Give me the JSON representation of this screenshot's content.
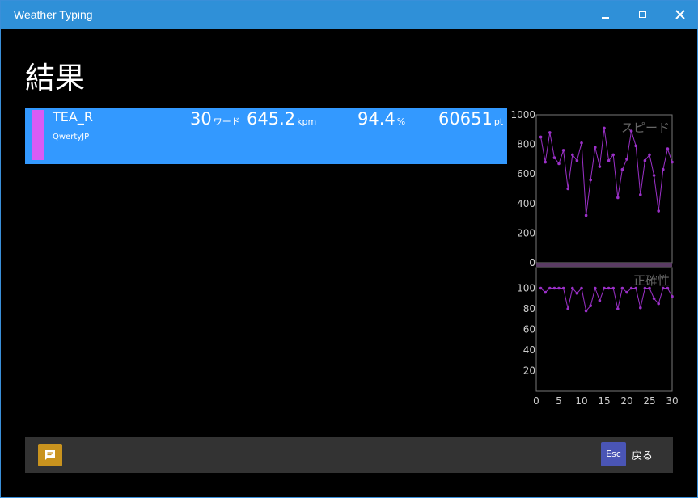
{
  "window": {
    "title": "Weather Typing"
  },
  "page": {
    "heading": "結果"
  },
  "result": {
    "player": "TEA_R",
    "layout": "QwertyJP",
    "words": "30",
    "words_unit": "ワード",
    "kpm": "645.2",
    "kpm_unit": "kpm",
    "accuracy": "94.4",
    "accuracy_unit": "%",
    "score": "60651",
    "score_unit": "pt",
    "color": "#d95cf5"
  },
  "footer": {
    "chat_icon": "chat-bubble-icon",
    "esc_key": "Esc",
    "back_label": "戻る"
  },
  "colors": {
    "titlebar": "#2f90d8",
    "result_row": "#3399ff",
    "series": "#9b30c8",
    "chat_button": "#c9931e",
    "esc_key": "#4a55b5"
  },
  "chart_data": [
    {
      "type": "line",
      "title": "スピード",
      "x": [
        1,
        2,
        3,
        4,
        5,
        6,
        7,
        8,
        9,
        10,
        11,
        12,
        13,
        14,
        15,
        16,
        17,
        18,
        19,
        20,
        21,
        22,
        23,
        24,
        25,
        26,
        27,
        28,
        29,
        30
      ],
      "values": [
        850,
        680,
        880,
        710,
        670,
        760,
        500,
        730,
        690,
        810,
        320,
        560,
        780,
        650,
        910,
        690,
        730,
        440,
        630,
        700,
        890,
        790,
        460,
        690,
        730,
        590,
        350,
        630,
        770,
        680
      ],
      "ylim": [
        0,
        1000
      ],
      "yticks": [
        "0",
        "200",
        "400",
        "600",
        "800",
        "1000"
      ]
    },
    {
      "type": "line",
      "title": "正確性",
      "x": [
        1,
        2,
        3,
        4,
        5,
        6,
        7,
        8,
        9,
        10,
        11,
        12,
        13,
        14,
        15,
        16,
        17,
        18,
        19,
        20,
        21,
        22,
        23,
        24,
        25,
        26,
        27,
        28,
        29,
        30
      ],
      "values": [
        100,
        96,
        100,
        100,
        100,
        100,
        80,
        100,
        95,
        100,
        78,
        83,
        100,
        88,
        100,
        100,
        100,
        80,
        100,
        96,
        100,
        100,
        81,
        100,
        100,
        90,
        85,
        100,
        100,
        92
      ],
      "ylim": [
        0,
        120
      ],
      "yticks": [
        "20",
        "40",
        "60",
        "80",
        "100"
      ],
      "xticks": [
        "0",
        "5",
        "10",
        "15",
        "20",
        "25",
        "30"
      ],
      "xlim": [
        0,
        30
      ]
    }
  ]
}
